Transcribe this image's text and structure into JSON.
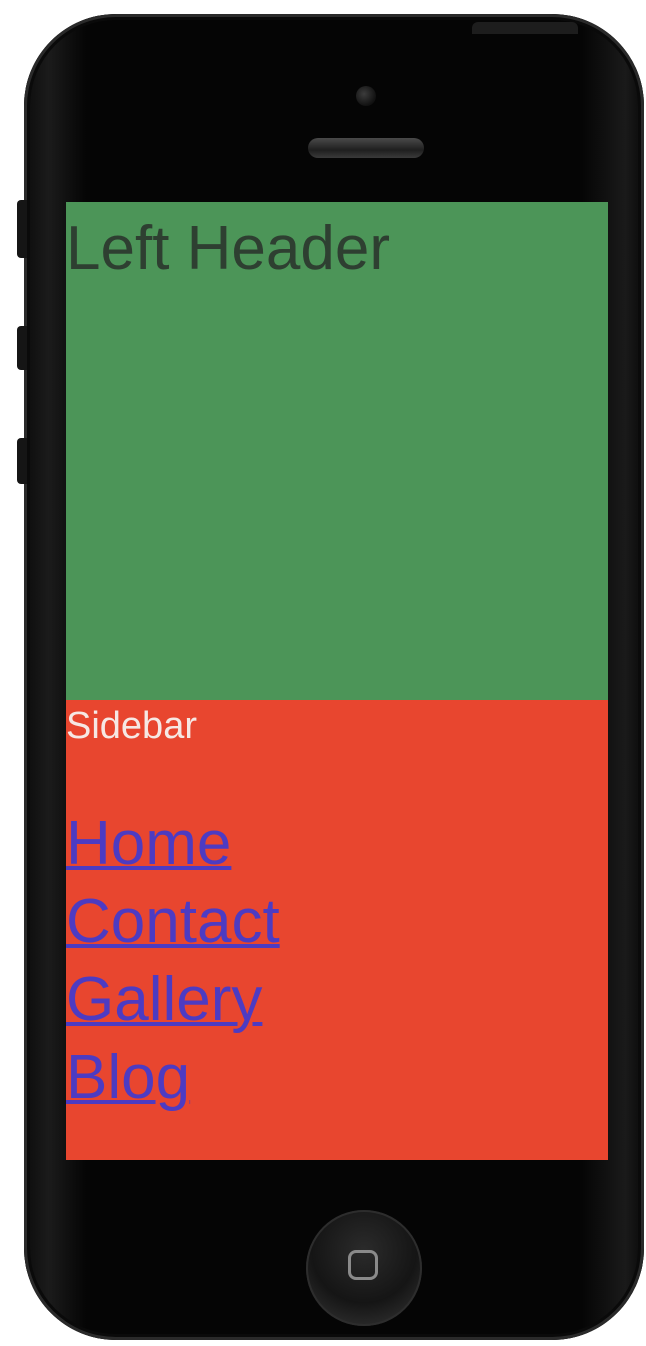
{
  "device": {
    "type": "smartphone",
    "home_button_icon": "rounded-square-icon",
    "body_color": "#050505"
  },
  "header": {
    "title": "Left Header",
    "background_color": "#4c9558",
    "text_color": "#2e3f31"
  },
  "sidebar": {
    "label": "Sidebar",
    "background_color": "#e8462f",
    "label_color": "#f6e8e4",
    "link_color": "#4d3bc2",
    "links": [
      {
        "label": "Home"
      },
      {
        "label": "Contact"
      },
      {
        "label": "Gallery"
      },
      {
        "label": "Blog"
      }
    ]
  }
}
